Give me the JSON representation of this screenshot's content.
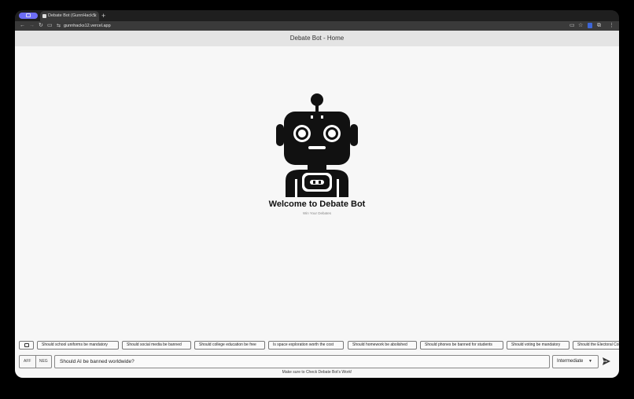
{
  "browser": {
    "tab_title": "Debate Bot (GunnHackS",
    "url": "gunnhacks12.vercel.app"
  },
  "app": {
    "header_title": "Debate Bot - Home",
    "welcome_title": "Welcome to Debate Bot",
    "welcome_subtitle": "Win Your Debates"
  },
  "suggestions": [
    "Should school uniforms be mandatory",
    "Should social media be banned",
    "Should college education be free",
    "Is space exploration worth the cost",
    "Should homework be abolished",
    "Should phones be banned for students",
    "Should voting be mandatory",
    "Should the Electoral College"
  ],
  "input": {
    "aff_label": "AFF",
    "neg_label": "NEG",
    "value": "Should AI be banned worldwide?",
    "level": "Intermediate"
  },
  "footer_note": "Make sure to Check Debate Bot's Work!",
  "colors": {
    "accent": "#6d6df5",
    "robot": "#111111"
  }
}
